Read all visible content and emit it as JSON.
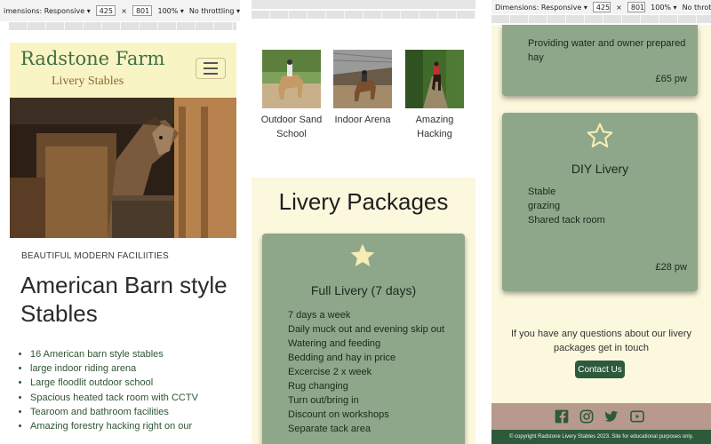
{
  "devtools": {
    "dimensions_label": "imensions: Responsive ▾",
    "dimensions_label_full": "Dimensions: Responsive ▾",
    "width": "425",
    "times": "×",
    "height": "801",
    "zoom": "100% ▾",
    "throttle": "No throttling ▾"
  },
  "navbar": {
    "brand": "Radstone Farm",
    "brand_sub": "Livery Stables"
  },
  "intro": {
    "subheading": "BEAUTIFUL MODERN FACILIITIES",
    "heading": "American Barn style Stables",
    "features": [
      "16 American barn style stables",
      "large indoor riding arena",
      "Large floodlit outdoor school",
      "Spacious heated tack room with CCTV",
      "Tearoom and bathroom facilities",
      "Amazing forestry hacking right on our"
    ]
  },
  "facilities": [
    {
      "label": "Outdoor Sand School"
    },
    {
      "label": "Indoor Arena"
    },
    {
      "label": "Amazing Hacking"
    }
  ],
  "packages": {
    "heading": "Livery Packages",
    "full": {
      "title": "Full Livery (7 days)",
      "items": [
        "7 days a week",
        "Daily muck out and evening skip out",
        "Watering and feeding",
        "Bedding and hay in price",
        "Excercise 2 x week",
        "Rug changing",
        "Turn out/bring in",
        "Discount on workshops",
        "Separate tack area"
      ]
    },
    "partial": {
      "items": [
        "Providing water and owner prepared",
        "hay"
      ],
      "price": "£65 pw"
    },
    "diy": {
      "title": "DIY Livery",
      "items": [
        "Stable",
        "grazing",
        "Shared tack room"
      ],
      "price": "£28 pw"
    }
  },
  "contact": {
    "question": "If you have any questions about our livery packages get in touch",
    "button": "Contact Us"
  },
  "footer": {
    "copyright": "© copyright Radstone Livery Stables 2023. Site for educational purposes only.",
    "icons": [
      "facebook-icon",
      "instagram-icon",
      "twitter-icon",
      "youtube-icon"
    ]
  },
  "colors": {
    "navbar_bg": "#f9f4c4",
    "brand_green": "#3f6f46",
    "cream_bg": "#fcf8dd",
    "card_green": "#8ea68a",
    "star": "#f6ecb4",
    "button_green": "#2e5a3c",
    "footer_bg": "#b79a8d"
  }
}
